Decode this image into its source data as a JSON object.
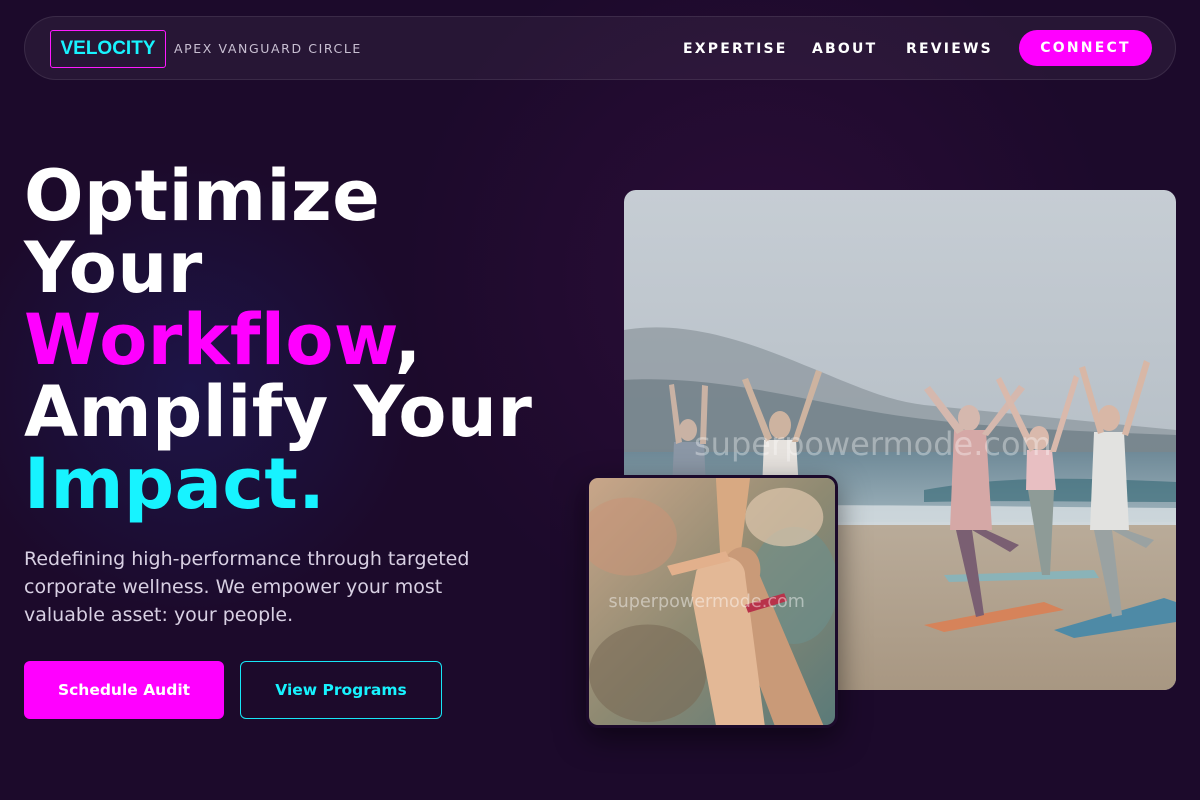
{
  "brand": {
    "logo_text": "VELOCITY",
    "tagline": "APEX VANGUARD CIRCLE"
  },
  "nav": {
    "links": [
      {
        "label": "EXPERTISE"
      },
      {
        "label": "ABOUT"
      },
      {
        "label": "REVIEWS"
      }
    ],
    "cta_label": "CONNECT"
  },
  "hero": {
    "title_line1": "Optimize",
    "title_line2": "Your",
    "title_highlight1": "Workflow",
    "title_comma": ",",
    "title_line4": "Amplify Your",
    "title_highlight2": "Impact.",
    "subtitle": "Redefining high-performance through targeted corporate wellness. We empower your most valuable asset: your people.",
    "primary_button": "Schedule Audit",
    "secondary_button": "View Programs"
  },
  "images": {
    "main_watermark": "superpowermode.com",
    "secondary_watermark": "superpowermode.com"
  },
  "colors": {
    "background": "#1c0a2b",
    "magenta": "#ff00ff",
    "cyan": "#17f3ff"
  }
}
